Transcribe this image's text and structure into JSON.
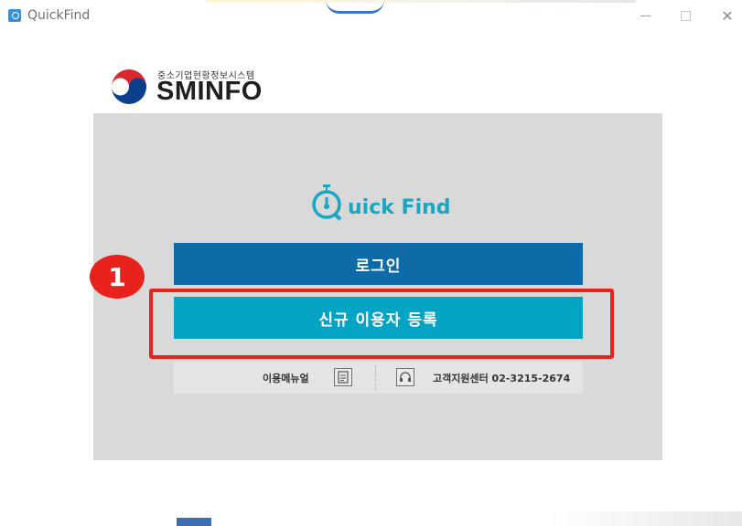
{
  "window": {
    "title": "QuickFind",
    "icon": "quickfind-app-icon",
    "controls": [
      "minimize-icon",
      "maximize-icon",
      "close-icon"
    ],
    "close_glyph": "✕"
  },
  "logo": {
    "sub_text": "중소기업현황정보시스템",
    "main_text": "SMINFO"
  },
  "quickfind": {
    "title_rest": "uick Find",
    "icon": "stopwatch-q-icon"
  },
  "buttons": {
    "login_label": "로그인",
    "register_label": "신규 이용자 등록"
  },
  "support": {
    "manual_label": "이용메뉴얼",
    "manual_icon": "manual-book-icon",
    "center_label": "고객지원센터 02-3215-2674",
    "center_icon": "headset-icon"
  },
  "annotation": {
    "badge_number": "1"
  },
  "colors": {
    "login_button": "#0f6ba8",
    "register_button": "#06a4c4",
    "panel_bg": "#d9d9d9",
    "highlight_red": "#e8231d",
    "brand_teal": "#1aa6c1"
  }
}
